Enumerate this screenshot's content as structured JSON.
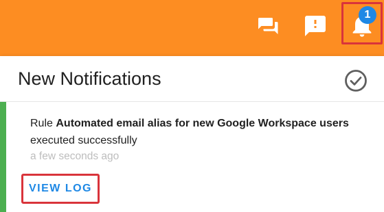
{
  "topbar": {
    "icons": [
      "chat-icon",
      "feedback-icon",
      "bell-icon"
    ],
    "notification_count": "1"
  },
  "panel": {
    "title": "New Notifications",
    "mark_all_read_icon": "check-circle-icon"
  },
  "notification": {
    "prefix": "Rule ",
    "rule_name": "Automated email alias for new Google Workspace users",
    "suffix": " executed successfully",
    "time": "a few seconds ago",
    "action_label": "VIEW LOG",
    "status_color": "#4caf50"
  },
  "colors": {
    "topbar": "#fd8d22",
    "accent_blue": "#1e88e5",
    "highlight_red": "#d9343b"
  }
}
